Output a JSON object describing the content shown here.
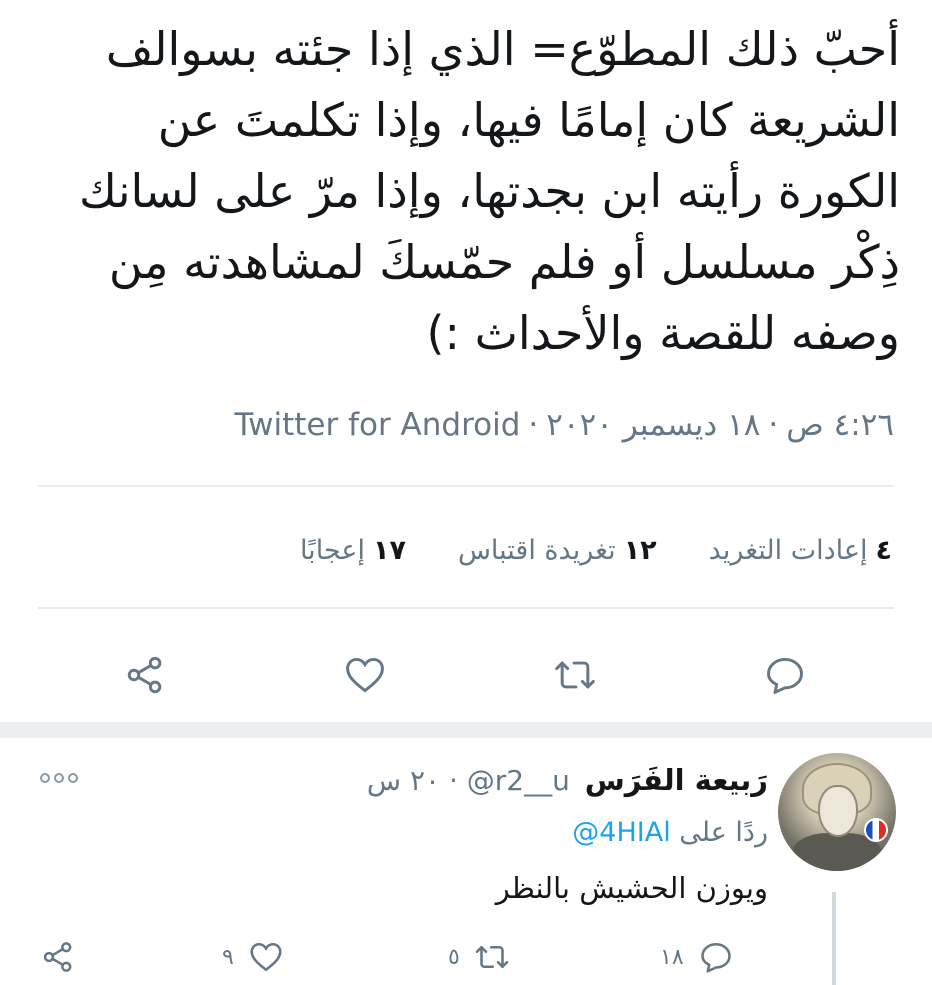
{
  "tweet": {
    "lines": [
      "أحبّ ذلك المطوّع= الذي إذا جئته بسوالف",
      "الشريعة كان إمامًا فيها، وإذا تكلمتَ عن",
      "الكورة رأيته ابن بجدتها، وإذا مرّ على لسانك",
      "ذِكْر مسلسل أو فلم حمّسكَ لمشاهدته مِن",
      "وصفه للقصة والأحداث :)"
    ],
    "time": "٤:٢٦ ص",
    "date": "١٨ ديسمبر ٢٠٢٠",
    "source": "Twitter for Android",
    "dot": "·"
  },
  "stats": {
    "retweets": {
      "count": "٤",
      "label": "إعادات التغريد"
    },
    "quotes": {
      "count": "١٢",
      "label": "تغريدة اقتباس"
    },
    "likes": {
      "count": "١٧",
      "label": "إعجابًا"
    }
  },
  "icons": {
    "reply": "reply-icon",
    "retweet": "retweet-icon",
    "like": "heart-icon",
    "share": "share-icon"
  },
  "colors": {
    "text": "#14171a",
    "secondary": "#657786",
    "icon": "#657786",
    "link": "#1da1f2",
    "divider": "#e6ecf0"
  },
  "reply": {
    "name": "رَبيعة الفَرَس",
    "handle": "@r2__u",
    "dot": "·",
    "time": "٢٠ س",
    "replying_label": "ردًا على",
    "replying_to": "@4HIAl",
    "text": "ويوزن الحشيش بالنظر",
    "counts": {
      "replies": "١٨",
      "retweets": "٥",
      "likes": "٩"
    }
  }
}
